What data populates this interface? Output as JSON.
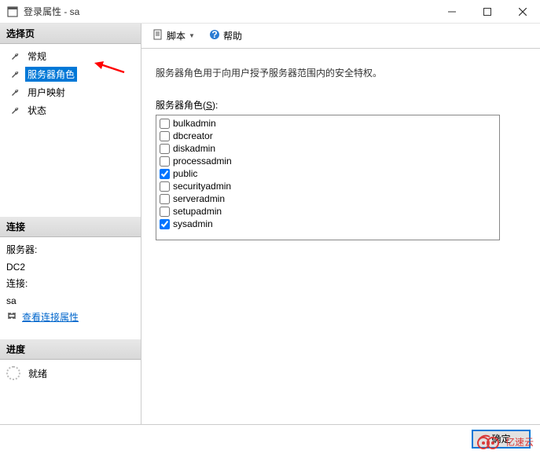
{
  "window": {
    "title": "登录属性 - sa"
  },
  "sidebar": {
    "select_page_header": "选择页",
    "items": [
      {
        "label": "常规"
      },
      {
        "label": "服务器角色"
      },
      {
        "label": "用户映射"
      },
      {
        "label": "状态"
      }
    ],
    "connection_header": "连接",
    "server_label": "服务器:",
    "server_value": "DC2",
    "conn_label": "连接:",
    "conn_value": "sa",
    "view_props": "查看连接属性",
    "progress_header": "进度",
    "progress_status": "就绪"
  },
  "toolbar": {
    "script": "脚本",
    "help": "帮助"
  },
  "content": {
    "description": "服务器角色用于向用户授予服务器范围内的安全特权。",
    "roles_label_prefix": "服务器角色(",
    "roles_label_key": "S",
    "roles_label_suffix": "):",
    "roles": [
      {
        "name": "bulkadmin",
        "checked": false
      },
      {
        "name": "dbcreator",
        "checked": false
      },
      {
        "name": "diskadmin",
        "checked": false
      },
      {
        "name": "processadmin",
        "checked": false
      },
      {
        "name": "public",
        "checked": true
      },
      {
        "name": "securityadmin",
        "checked": false
      },
      {
        "name": "serveradmin",
        "checked": false
      },
      {
        "name": "setupadmin",
        "checked": false
      },
      {
        "name": "sysadmin",
        "checked": true
      }
    ]
  },
  "footer": {
    "ok": "确定"
  },
  "watermark": "亿速云"
}
